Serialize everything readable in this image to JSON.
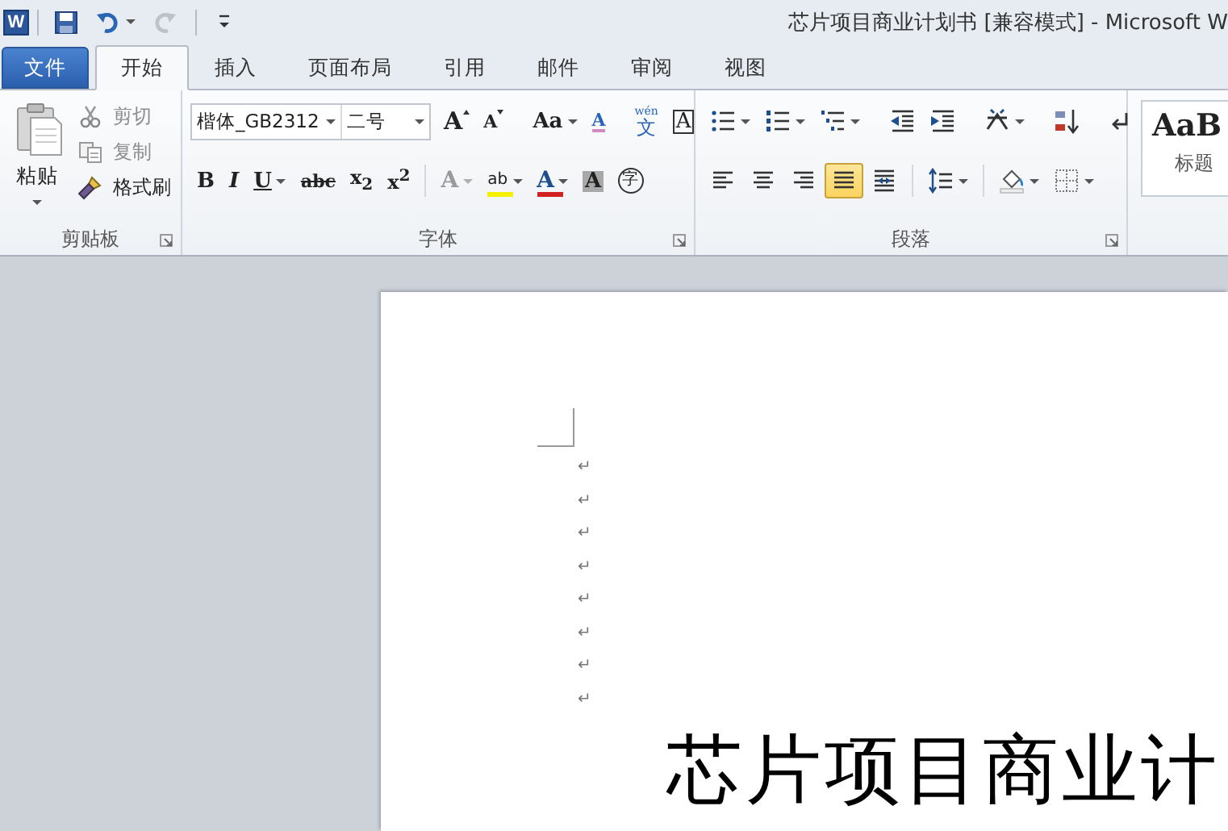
{
  "title_bar": {
    "app_icon": "W",
    "title": "芯片项目商业计划书 [兼容模式] - Microsoft W",
    "quick_access": [
      {
        "kind": "save",
        "dropdown": false,
        "disabled": false
      },
      {
        "kind": "undo",
        "dropdown": true,
        "disabled": false
      },
      {
        "kind": "redo",
        "dropdown": false,
        "disabled": true
      },
      {
        "kind": "customize",
        "dropdown": false,
        "disabled": false
      }
    ]
  },
  "tabs": [
    {
      "label": "文件",
      "kind": "file",
      "selected": false
    },
    {
      "label": "开始",
      "kind": "tab",
      "selected": true
    },
    {
      "label": "插入",
      "kind": "tab",
      "selected": false
    },
    {
      "label": "页面布局",
      "kind": "tab",
      "selected": false
    },
    {
      "label": "引用",
      "kind": "tab",
      "selected": false
    },
    {
      "label": "邮件",
      "kind": "tab",
      "selected": false
    },
    {
      "label": "审阅",
      "kind": "tab",
      "selected": false
    },
    {
      "label": "视图",
      "kind": "tab",
      "selected": false
    }
  ],
  "clipboard": {
    "label": "剪贴板",
    "paste": "粘贴",
    "items": [
      {
        "kind": "cut",
        "label": "剪切",
        "disabled": true
      },
      {
        "kind": "copy",
        "label": "复制",
        "disabled": true
      },
      {
        "kind": "painter",
        "label": "格式刷",
        "disabled": false
      }
    ]
  },
  "font": {
    "label": "字体",
    "font_name": "楷体_GB2312",
    "font_size": "二号",
    "row_1": [
      {
        "kind": "grow",
        "label": "A",
        "dropdown": false,
        "disabled": false
      },
      {
        "kind": "shrink",
        "label": "A",
        "dropdown": false,
        "disabled": false
      },
      {
        "kind": "case",
        "label": "Aa",
        "dropdown": true,
        "disabled": false
      },
      {
        "kind": "clear",
        "label": "A",
        "dropdown": false,
        "disabled": false
      },
      {
        "kind": "phonetic",
        "label": "文",
        "ruby": "wén",
        "dropdown": false,
        "disabled": false
      },
      {
        "kind": "border",
        "label": "A",
        "dropdown": false,
        "disabled": false
      }
    ],
    "row_2": [
      {
        "kind": "bold",
        "label": "B",
        "dropdown": false,
        "disabled": false
      },
      {
        "kind": "italic",
        "label": "I",
        "dropdown": false,
        "disabled": false
      },
      {
        "kind": "underline",
        "label": "U",
        "dropdown": true,
        "disabled": false
      },
      {
        "kind": "strike",
        "label": "abc",
        "dropdown": false,
        "disabled": false
      },
      {
        "kind": "script",
        "label": "x$_{2}$",
        "dropdown": false,
        "disabled": false
      },
      {
        "kind": "script",
        "label": "x$^{2}$",
        "dropdown": false,
        "disabled": false
      },
      {
        "kind": "effect",
        "label": "A",
        "dropdown": true,
        "disabled": true
      },
      {
        "kind": "highlight",
        "label": "ab",
        "dropdown": true,
        "disabled": false
      },
      {
        "kind": "color",
        "label": "A",
        "dropdown": true,
        "disabled": false
      },
      {
        "kind": "shade",
        "label": "A",
        "dropdown": false,
        "disabled": false
      },
      {
        "kind": "enclose",
        "label": "字",
        "dropdown": false,
        "disabled": false
      }
    ]
  },
  "paragraph": {
    "label": "段落",
    "row_1": [
      {
        "kind": "bullets",
        "dropdown": true,
        "selected": false
      },
      {
        "kind": "numbering",
        "dropdown": true,
        "selected": false
      },
      {
        "kind": "multilevel",
        "dropdown": true,
        "selected": false
      },
      {
        "kind": "outdent",
        "dropdown": false,
        "selected": false
      },
      {
        "kind": "indent",
        "dropdown": false,
        "selected": false
      },
      {
        "kind": "asian",
        "dropdown": true,
        "selected": false
      },
      {
        "kind": "sort",
        "dropdown": false,
        "selected": false
      },
      {
        "kind": "marks",
        "dropdown": false,
        "selected": false
      }
    ],
    "row_2": [
      {
        "kind": "left",
        "dropdown": false,
        "selected": false
      },
      {
        "kind": "center",
        "dropdown": false,
        "selected": false
      },
      {
        "kind": "right",
        "dropdown": false,
        "selected": false
      },
      {
        "kind": "justify",
        "dropdown": false,
        "selected": true
      },
      {
        "kind": "distribute",
        "dropdown": false,
        "selected": false
      },
      {
        "kind": "spacing",
        "dropdown": true,
        "selected": false
      },
      {
        "kind": "shading",
        "dropdown": true,
        "selected": false
      },
      {
        "kind": "borders",
        "dropdown": true,
        "selected": false
      }
    ]
  },
  "styles": {
    "preview": "AaB",
    "name": "标题"
  },
  "document": {
    "paragraph_marks": [
      "↵",
      "↵",
      "↵",
      "↵",
      "↵",
      "↵",
      "↵",
      "↵"
    ],
    "heading": "芯片项目商业计"
  }
}
